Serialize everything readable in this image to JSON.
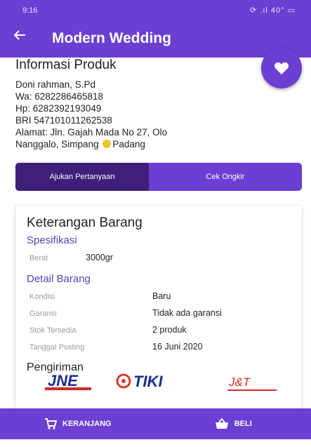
{
  "status_bar": {
    "time": "9:16",
    "icons": "⟳ .ıl 40° ▭"
  },
  "app_bar": {
    "back_icon": "arrow-left-icon",
    "title": "Modern Wedding"
  },
  "favorite": {
    "icon": "heart-icon"
  },
  "info": {
    "title": "Informasi Produk",
    "name": "Doni rahman, S.Pd",
    "wa": "Wa: 6282286465818",
    "hp": "Hp: 6282392193049",
    "bank": "BRI 547101011262538",
    "address_1": "Alamat: Jln. Gajah Mada No 27, Olo",
    "address_2_a": "Nanggalo, Simpang",
    "address_2_b": "Padang"
  },
  "actions": {
    "ask": "Ajukan Pertanyaan",
    "shipping": "Cek Ongkir"
  },
  "details": {
    "title": "Keterangan Barang",
    "spec_heading": "Spesifikasi",
    "weight_label": "Berat",
    "weight_value": "3000gr",
    "detail_heading": "Detail Barang",
    "condition_label": "Kondisi",
    "condition_value": "Baru",
    "warranty_label": "Garansi",
    "warranty_value": "Tidak ada garansi",
    "stock_label": "Stok Tersedia",
    "stock_value": "2 produk",
    "posted_label": "Tanggal Posting",
    "posted_value": "16 Juni 2020",
    "shipping_heading": "Pengiriman",
    "couriers": [
      "JNE",
      "TIKI",
      "J&T"
    ]
  },
  "bottom": {
    "cart": "KERANJANG",
    "buy": "BELI"
  },
  "colors": {
    "primary": "#6a3fd2",
    "primary_dark": "#3f1f7a",
    "accent_text": "#5a3fb8"
  }
}
